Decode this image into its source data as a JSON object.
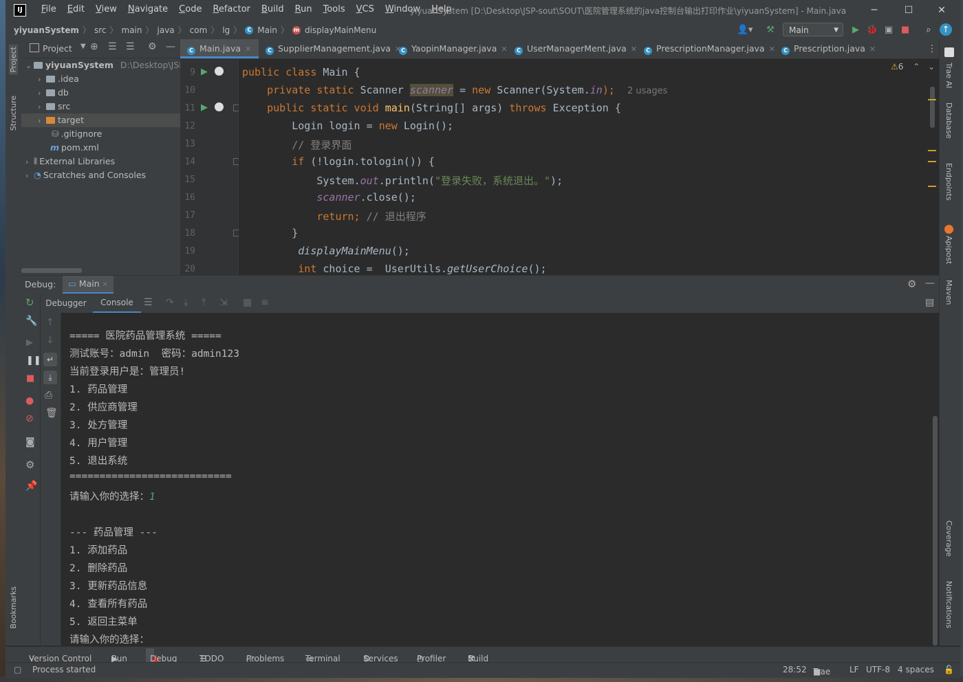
{
  "window": {
    "title": "yiyuanSystem [D:\\Desktop\\JSP-sout\\SOUT\\医院管理系统的java控制台输出打印作业\\yiyuanSystem] - Main.java",
    "logo": "IJ",
    "controls": {
      "minimize": "─",
      "maximize": "☐",
      "close": "✕"
    }
  },
  "menu": [
    "File",
    "Edit",
    "View",
    "Navigate",
    "Code",
    "Refactor",
    "Build",
    "Run",
    "Tools",
    "VCS",
    "Window",
    "Help"
  ],
  "breadcrumbs": [
    "yiyuanSystem",
    "src",
    "main",
    "java",
    "com",
    "lg",
    "Main",
    "displayMainMenu"
  ],
  "toolbar": {
    "run_config": "Main"
  },
  "project": {
    "header": "Project",
    "tree": [
      {
        "label": "yiyuanSystem",
        "path": "D:\\Desktop\\JSP-s"
      },
      {
        "label": ".idea"
      },
      {
        "label": "db"
      },
      {
        "label": "src"
      },
      {
        "label": "target"
      },
      {
        "label": ".gitignore"
      },
      {
        "label": "pom.xml"
      },
      {
        "label": "External Libraries"
      },
      {
        "label": "Scratches and Consoles"
      }
    ]
  },
  "tabs": [
    {
      "label": "Main.java",
      "active": true
    },
    {
      "label": "SupplierManagement.java"
    },
    {
      "label": "YaopinManager.java"
    },
    {
      "label": "UserManagerMent.java"
    },
    {
      "label": "PrescriptionManager.java"
    },
    {
      "label": "Prescription.java"
    }
  ],
  "editor": {
    "warnings": "6",
    "line_numbers": [
      "9",
      "10",
      "11",
      "12",
      "13",
      "14",
      "15",
      "16",
      "17",
      "18",
      "19",
      "20"
    ],
    "usages_hint": "2 usages",
    "code": {
      "l9a": "public class ",
      "l9b": "Main {",
      "l10a": "    private static ",
      "l10b": "Scanner ",
      "l10c": "scanner",
      "l10d": " = ",
      "l10e": "new ",
      "l10f": "Scanner(System.",
      "l10g": "in",
      "l10h": ");",
      "l11a": "    public static void ",
      "l11b": "main",
      "l11c": "(String[] args) ",
      "l11d": "throws ",
      "l11e": "Exception {",
      "l12a": "        Login login = ",
      "l12b": "new ",
      "l12c": "Login();",
      "l13": "        // 登录界面",
      "l14a": "        if ",
      "l14b": "(!login.tologin()) {",
      "l15a": "            System.",
      "l15b": "out",
      "l15c": ".println(",
      "l15d": "\"登录失败，系统退出。\"",
      "l15e": ");",
      "l16a": "            ",
      "l16b": "scanner",
      "l16c": ".close();",
      "l17a": "            return; ",
      "l17b": "// 退出程序",
      "l18": "        }",
      "l19a": "         ",
      "l19b": "displayMainMenu",
      "l19c": "();",
      "l20a": "         int ",
      "l20b": "choice =  UserUtils.",
      "l20c": "getUserChoice",
      "l20d": "();"
    }
  },
  "debug": {
    "label": "Debug:",
    "session_tab": "Main",
    "tabs": [
      "Debugger",
      "Console"
    ],
    "console_lines": [
      "===== 医院药品管理系统 =====",
      "测试账号：admin  密码：admin123",
      "当前登录用户是：管理员!",
      "1. 药品管理",
      "2. 供应商管理",
      "3. 处方管理",
      "4. 用户管理",
      "5. 退出系统",
      "===========================",
      "请输入你的选择：",
      "",
      "--- 药品管理 ---",
      "1. 添加药品",
      "2. 删除药品",
      "3. 更新药品信息",
      "4. 查看所有药品",
      "5. 返回主菜单",
      "请输入你的选择："
    ],
    "user_input": "1"
  },
  "left_strip": [
    "Project",
    "Structure",
    "Bookmarks"
  ],
  "right_strip": [
    "Trae AI",
    "Database",
    "Endpoints",
    "Apipost",
    "Maven",
    "Coverage",
    "Notifications"
  ],
  "tool_windows": [
    "Version Control",
    "Run",
    "Debug",
    "TODO",
    "Problems",
    "Terminal",
    "Services",
    "Profiler",
    "Build"
  ],
  "status": {
    "message": "Process started",
    "position": "28:52",
    "plugin": "Trae",
    "line_sep": "LF",
    "encoding": "UTF-8",
    "indent": "4 spaces"
  },
  "colors": {
    "accent": "#4a88c7",
    "keyword": "#cc7832",
    "string": "#6a8759",
    "field": "#9876aa",
    "method": "#ffc66d"
  }
}
